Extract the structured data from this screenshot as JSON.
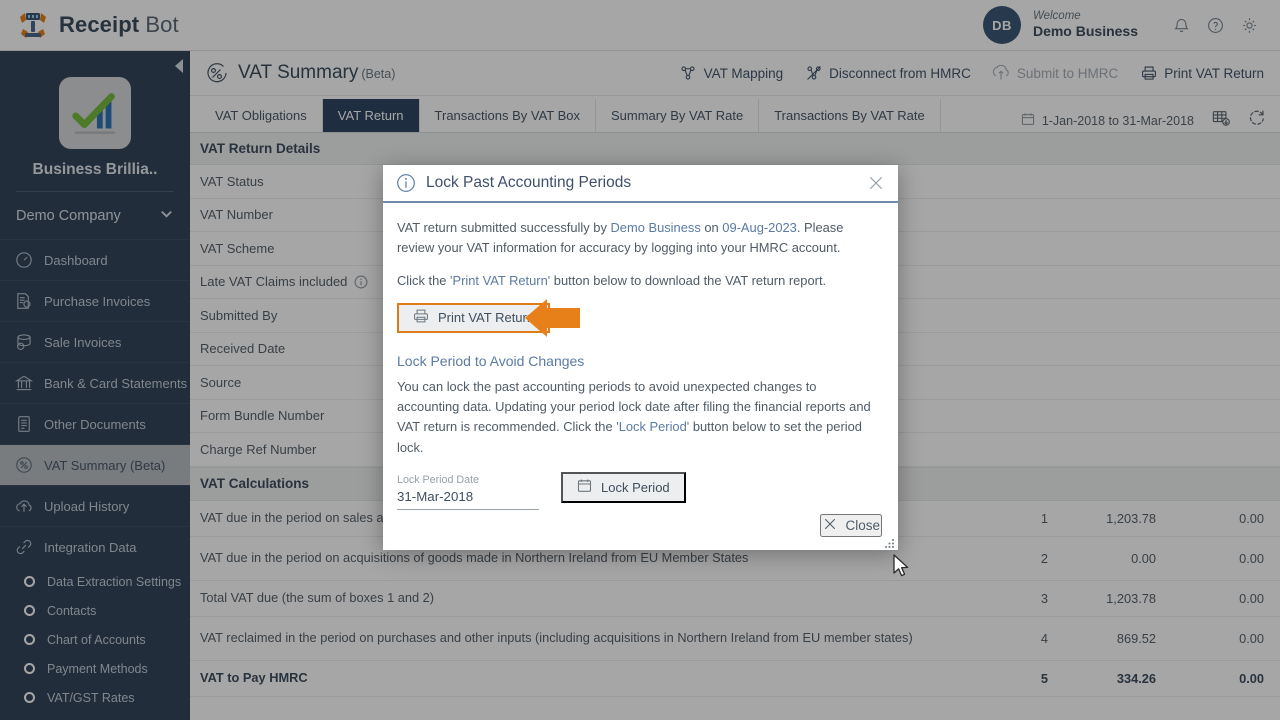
{
  "topbar": {
    "brand_bold": "Receipt",
    "brand_light": " Bot",
    "logo_icon": "robot-logo-icon",
    "avatar_initials": "DB",
    "welcome_label": "Welcome",
    "user_name": "Demo Business",
    "icons": [
      "bell-icon",
      "help-circle-icon",
      "gear-icon"
    ]
  },
  "sidebar": {
    "collapse_icon": "collapse-left-arrow-icon",
    "logo_icon": "business-brilliance-logo-icon",
    "company_title": "Business Brillia..",
    "company_selector": "Demo Company",
    "company_selector_icon": "chevron-down-icon",
    "items": [
      {
        "label": "Dashboard",
        "icon": "dashboard-gauge-icon",
        "active": false
      },
      {
        "label": "Purchase Invoices",
        "icon": "purchase-invoice-icon",
        "active": false
      },
      {
        "label": "Sale Invoices",
        "icon": "sale-invoice-icon",
        "active": false
      },
      {
        "label": "Bank & Card Statements",
        "icon": "bank-icon",
        "active": false
      },
      {
        "label": "Other Documents",
        "icon": "document-icon",
        "active": false
      },
      {
        "label": "VAT Summary (Beta)",
        "icon": "percent-circle-icon",
        "active": true
      },
      {
        "label": "Upload History",
        "icon": "upload-cloud-icon",
        "active": false
      },
      {
        "label": "Integration Data",
        "icon": "link-chain-icon",
        "active": false
      }
    ],
    "sub_items": [
      {
        "label": "Data Extraction Settings"
      },
      {
        "label": "Contacts"
      },
      {
        "label": "Chart of Accounts"
      },
      {
        "label": "Payment Methods"
      },
      {
        "label": "VAT/GST Rates"
      }
    ]
  },
  "page": {
    "icon": "percent-circle-icon",
    "title": "VAT Summary",
    "beta": "(Beta)",
    "actions": [
      {
        "label": "VAT Mapping",
        "icon": "mapping-nodes-icon",
        "disabled": false
      },
      {
        "label": "Disconnect from HMRC",
        "icon": "disconnect-nodes-icon",
        "disabled": false
      },
      {
        "label": "Submit to HMRC",
        "icon": "upload-arrow-icon",
        "disabled": true
      },
      {
        "label": "Print VAT Return",
        "icon": "printer-icon",
        "disabled": false
      }
    ]
  },
  "tabs": [
    {
      "label": "VAT Obligations",
      "active": false
    },
    {
      "label": "VAT Return",
      "active": true
    },
    {
      "label": "Transactions By VAT Box",
      "active": false
    },
    {
      "label": "Summary By VAT Rate",
      "active": false
    },
    {
      "label": "Transactions By VAT Rate",
      "active": false
    }
  ],
  "tabbar_right": {
    "calendar_icon": "calendar-icon",
    "date_range": "1-Jan-2018 to 31-Mar-2018",
    "grid_export_icon": "grid-export-icon",
    "refresh_icon": "refresh-icon"
  },
  "details": {
    "section_title": "VAT Return Details",
    "rows": [
      {
        "label": "VAT Status",
        "value": "",
        "info": false
      },
      {
        "label": "VAT Number",
        "value": "",
        "info": false
      },
      {
        "label": "VAT Scheme",
        "value": "",
        "info": false
      },
      {
        "label": "Late VAT Claims included",
        "value": "",
        "info": true
      },
      {
        "label": "Submitted By",
        "value": "",
        "info": false
      },
      {
        "label": "Received Date",
        "value": "",
        "info": false
      },
      {
        "label": "Source",
        "value": "",
        "info": false
      },
      {
        "label": "Form Bundle Number",
        "value": "",
        "info": false
      },
      {
        "label": "Charge Ref Number",
        "value": "",
        "info": false
      }
    ]
  },
  "calculations": {
    "section_title": "VAT Calculations",
    "rows": [
      {
        "desc": "VAT due in the period on sales and other outputs",
        "box": "1",
        "amount": "1,203.78",
        "amount2": "0.00",
        "bold": false,
        "tall": false
      },
      {
        "desc": "VAT due in the period on acquisitions of goods made in Northern Ireland from EU Member States",
        "box": "2",
        "amount": "0.00",
        "amount2": "0.00",
        "bold": false,
        "tall": true
      },
      {
        "desc": "Total VAT due (the sum of boxes 1 and 2)",
        "box": "3",
        "amount": "1,203.78",
        "amount2": "0.00",
        "bold": false,
        "tall": false
      },
      {
        "desc": "VAT reclaimed in the period on purchases and other inputs (including acquisitions in Northern Ireland from EU member states)",
        "box": "4",
        "amount": "869.52",
        "amount2": "0.00",
        "bold": false,
        "tall": true
      },
      {
        "desc": "VAT to Pay HMRC",
        "box": "5",
        "amount": "334.26",
        "amount2": "0.00",
        "bold": true,
        "tall": false
      }
    ]
  },
  "modal": {
    "info_icon": "info-circle-icon",
    "title": "Lock Past Accounting Periods",
    "close_icon": "close-x-icon",
    "para1_a": "VAT return submitted successfully by ",
    "para1_link1": "Demo Business",
    "para1_b": " on ",
    "para1_link2": "09-Aug-2023",
    "para1_c": ". Please review your VAT information for accuracy by logging into your HMRC account.",
    "para2_a": "Click the ",
    "para2_link": "'Print VAT Return'",
    "para2_b": " button below to download the VAT return report.",
    "print_button": "Print VAT Return",
    "print_button_icon": "printer-icon",
    "arrow_icon": "left-pointing-arrow-icon",
    "highlight_color": "#e8801a",
    "subhead": "Lock Period to Avoid Changes",
    "para3_a": "You can lock the past accounting periods to avoid unexpected changes to accounting data. Updating your period lock date after filing the financial reports and VAT return is recommended. Click the ",
    "para3_link": "'Lock Period'",
    "para3_b": " button below to set the period lock.",
    "date_field_label": "Lock Period Date",
    "date_field_value": "31-Mar-2018",
    "lock_button": "Lock Period",
    "lock_button_icon": "calendar-icon",
    "close_button": "Close",
    "close_button_icon": "close-x-icon",
    "resize_icon": "resize-grip-icon"
  },
  "cursor": {
    "icon": "mouse-pointer-icon"
  }
}
